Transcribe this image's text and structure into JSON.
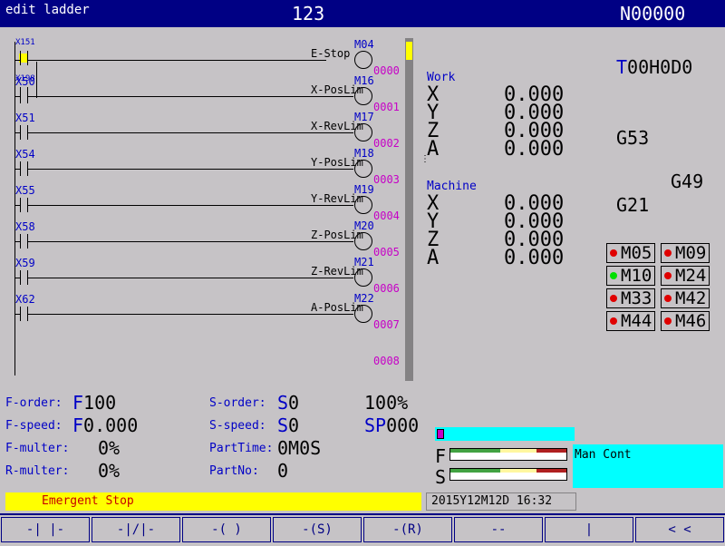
{
  "title": {
    "mode": "edit ladder",
    "program": "123",
    "block": "N00000"
  },
  "ladder": {
    "first_contact_a": "X151",
    "first_contact_b": "X198",
    "rungs": [
      {
        "contact": "",
        "coil_name": "E-Stop",
        "coil_addr": "M04",
        "line": "0000"
      },
      {
        "contact": "X50",
        "coil_name": "X-PosLim",
        "coil_addr": "M16",
        "line": "0001"
      },
      {
        "contact": "X51",
        "coil_name": "X-RevLim",
        "coil_addr": "M17",
        "line": "0002"
      },
      {
        "contact": "X54",
        "coil_name": "Y-PosLim",
        "coil_addr": "M18",
        "line": "0003"
      },
      {
        "contact": "X55",
        "coil_name": "Y-RevLim",
        "coil_addr": "M19",
        "line": "0004"
      },
      {
        "contact": "X58",
        "coil_name": "Z-PosLim",
        "coil_addr": "M20",
        "line": "0005"
      },
      {
        "contact": "X59",
        "coil_name": "Z-RevLim",
        "coil_addr": "M21",
        "line": "0006"
      },
      {
        "contact": "X62",
        "coil_name": "A-PosLim",
        "coil_addr": "M22",
        "line": "0007"
      }
    ],
    "last_line": "0008"
  },
  "position": {
    "work_label": "Work",
    "machine_label": "Machine",
    "work": [
      {
        "axis": "X",
        "value": "0.000"
      },
      {
        "axis": "Y",
        "value": "0.000"
      },
      {
        "axis": "Z",
        "value": "0.000"
      },
      {
        "axis": "A",
        "value": "0.000"
      }
    ],
    "machine": [
      {
        "axis": "X",
        "value": "0.000"
      },
      {
        "axis": "Y",
        "value": "0.000"
      },
      {
        "axis": "Z",
        "value": "0.000"
      },
      {
        "axis": "A",
        "value": "0.000"
      }
    ]
  },
  "modal": {
    "tool_prefix": "T",
    "tool_rest": "00H0D0",
    "g53": "G53",
    "g49": "G49",
    "g21": "G21"
  },
  "mcodes": [
    {
      "label": "M05",
      "color": "#e00000"
    },
    {
      "label": "M09",
      "color": "#e00000"
    },
    {
      "label": "M10",
      "color": "#00e000"
    },
    {
      "label": "M24",
      "color": "#e00000"
    },
    {
      "label": "M33",
      "color": "#e00000"
    },
    {
      "label": "M42",
      "color": "#e00000"
    },
    {
      "label": "M44",
      "color": "#e00000"
    },
    {
      "label": "M46",
      "color": "#e00000"
    }
  ],
  "status": {
    "f_order_label": "F-order:",
    "f_order_prefix": "F",
    "f_order_value": "100",
    "f_speed_label": "F-speed:",
    "f_speed_prefix": "F",
    "f_speed_value": "0.000",
    "f_multer_label": "F-multer:",
    "f_multer_value": "0%",
    "r_multer_label": "R-multer:",
    "r_multer_value": "0%",
    "s_order_label": "S-order:",
    "s_order_prefix": "S",
    "s_order_value": "0",
    "s_speed_label": "S-speed:",
    "s_speed_prefix": "S",
    "s_speed_value": "0",
    "part_time_label": "PartTime:",
    "part_time_value": "0M0S",
    "part_no_label": "PartNo:",
    "part_no_value": "0",
    "spindle_pct": "100%",
    "sp_prefix": "SP",
    "sp_value": "000"
  },
  "overrides": {
    "f_label": "F",
    "s_label": "S"
  },
  "mode_text": "Man Cont",
  "alarm_text": "Emergent Stop",
  "datetime": "2015Y12M12D 16:32",
  "softkeys": [
    "-| |-",
    "-|/|-",
    "-( )",
    "-(S)",
    "-(R)",
    "--",
    "|",
    "< <"
  ]
}
